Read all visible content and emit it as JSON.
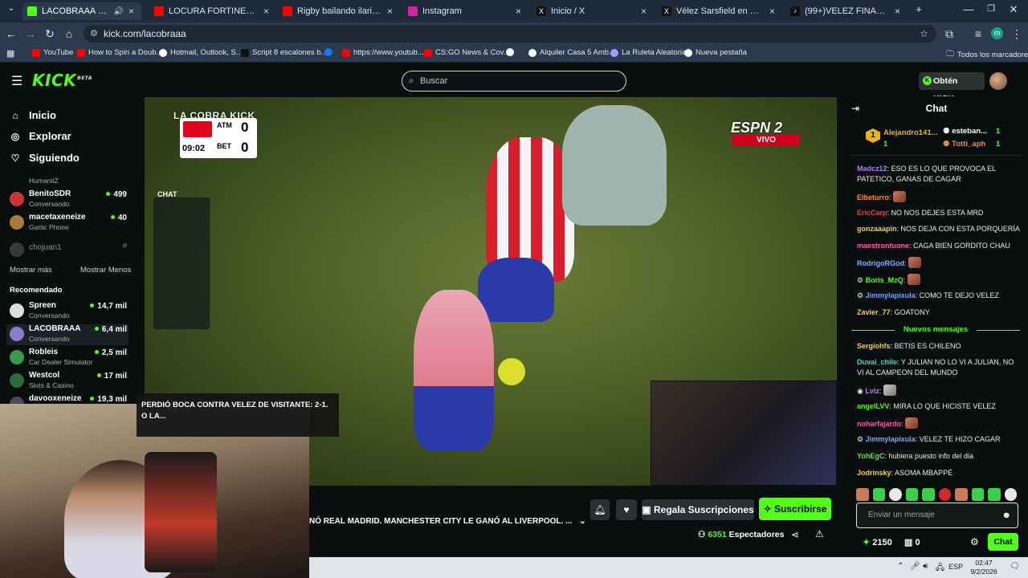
{
  "browser": {
    "tabs": [
      {
        "title": "LACOBRAAA Stream - Watc",
        "active": true,
        "color": "#53fc18"
      },
      {
        "title": "LOCURA FORTINERA | VÉLEZ 2",
        "color": "#ff0000"
      },
      {
        "title": "Rigby bailando ilarie, ilari larie",
        "color": "#ff0000"
      },
      {
        "title": "Instagram",
        "color": "#d6249f"
      },
      {
        "title": "Inicio / X",
        "color": "#111111"
      },
      {
        "title": "Vélez Sarsfield en X: \"Guille y la",
        "color": "#111111"
      },
      {
        "title": "(99+)VELEZ FINALISTA VAMOO",
        "color": "#111111"
      }
    ],
    "new_tab": "+",
    "url": "kick.com/lacobraaa",
    "bookmarks": [
      {
        "label": "YouTube",
        "color": "#ff0000"
      },
      {
        "label": "How to Spin a Doub...",
        "color": "#ff0000"
      },
      {
        "label": "Hotmail, Outlook, S...",
        "color": "#ffffff"
      },
      {
        "label": "Script 8 escalones b...",
        "color": "#222222"
      },
      {
        "label": "",
        "color": "#1877f2"
      },
      {
        "label": "https://www.youtub...",
        "color": "#ff0000"
      },
      {
        "label": "CS:GO News & Cov...",
        "color": "#ff0000"
      },
      {
        "label": "",
        "color": "#ffffff"
      },
      {
        "label": "Alquiler Casa 5 Amb...",
        "color": "#ffffff"
      },
      {
        "label": "La Ruleta Aleatoria",
        "color": "#a0a0ff"
      },
      {
        "label": "Nueva pestaña",
        "color": "#ffffff"
      }
    ],
    "all_bookmarks": "Todos los marcadores"
  },
  "header": {
    "logo": "KICK",
    "logo_beta": "BETA",
    "search_placeholder": "Buscar",
    "get_kicks": "Obtén KICKs"
  },
  "sidebar": {
    "nav": [
      {
        "label": "Inicio",
        "icon": "home-icon"
      },
      {
        "label": "Explorar",
        "icon": "compass-icon"
      },
      {
        "label": "Siguiendo",
        "icon": "heart-icon"
      }
    ],
    "following": [
      {
        "name": "HumanitZ",
        "sub": "",
        "viewers": ""
      },
      {
        "name": "BenitoSDR",
        "sub": "Conversando",
        "viewers": "499"
      },
      {
        "name": "macetaxeneize",
        "sub": "Gartic Phone",
        "viewers": "40"
      },
      {
        "name": "chojuan1",
        "sub": "",
        "viewers": ""
      }
    ],
    "show_more": "Mostrar más",
    "show_less": "Mostrar Menos",
    "recommended_title": "Recomendado",
    "recommended": [
      {
        "name": "Spreen",
        "sub": "Conversando",
        "viewers": "14,7 mil"
      },
      {
        "name": "LACOBRAAA",
        "sub": "Conversando",
        "viewers": "6,4 mil"
      },
      {
        "name": "Robleis",
        "sub": "Car Dealer Simulator",
        "viewers": "2,5 mil"
      },
      {
        "name": "Westcol",
        "sub": "Slots & Casino",
        "viewers": "17 mil"
      },
      {
        "name": "davooxeneize",
        "sub": "",
        "viewers": "19,3 mil"
      }
    ]
  },
  "video": {
    "overlay_brand": "LA COBRA KICK",
    "score": {
      "team1": "ATM",
      "team2": "BET",
      "score1": "0",
      "score2": "0",
      "clock": "09:02"
    },
    "broadcaster": "ESPN 2",
    "live_label": "VIVO",
    "chat_overlay_label": "CHAT",
    "ticker_text": "PERDIÓ BOCA CONTRA VELEZ DE VISITANTE: 2-1. O LA..."
  },
  "stream": {
    "title": "NÓ REAL MADRID. MANCHESTER CITY LE GANÓ AL LIVERPOOL. ...",
    "gift_subs": "Regala Suscripciones",
    "subscribe": "Suscribirse",
    "viewers": "6351",
    "viewers_label": "Espectadores"
  },
  "chat": {
    "title": "Chat",
    "leaderboard": [
      {
        "rank": "1",
        "name": "Alejandro141...",
        "count": "1"
      },
      {
        "name": "esteban...",
        "count": "1"
      },
      {
        "name": "Totti_aph",
        "count": "1"
      }
    ],
    "messages": [
      {
        "user": "Madcz12",
        "color": "#b57bff",
        "text": "ESO ES LO QUE PROVOCA EL PATETICO, GANAS DE CAGAR"
      },
      {
        "user": "Elbeturro",
        "color": "#ff8c3a",
        "text": ""
      },
      {
        "user": "EricCarp",
        "color": "#ff3c3c",
        "text": "NO NOS DEJES ESTA MRD"
      },
      {
        "user": "gonzaaapin",
        "color": "#f2d14b",
        "text": "NOS DEJA CON ESTA PORQUERÍA"
      },
      {
        "user": "maestrontuone",
        "color": "#ff5fa2",
        "text": "CAGA BIEN GORDITO CHAU"
      },
      {
        "user": "RodrigoRGod",
        "color": "#7fb0ff",
        "text": ""
      },
      {
        "user": "Boris_MzQ",
        "color": "#53fc18",
        "text": ""
      },
      {
        "user": "Jimmylapixula",
        "color": "#6fa8ff",
        "text": "COMO TE DEJO VELEZ"
      },
      {
        "user": "Zavier_77",
        "color": "#f2d14b",
        "text": "GOATONY"
      }
    ],
    "new_messages_label": "Nuevos mensajes",
    "new_messages": [
      {
        "user": "Sergiohfs",
        "color": "#f2d14b",
        "text": "BETIS ES CHILENO"
      },
      {
        "user": "Duvai_chile",
        "color": "#4bd6c0",
        "text": "Y JULIAN NO LO VI A JULIAN, NO VI AL CAMPEON DEL MUNDO"
      },
      {
        "user": "Lviz",
        "color": "#c07bff",
        "text": ""
      },
      {
        "user": "angelLVV",
        "color": "#53fc18",
        "text": "MIRA LO QUE HICISTE VELEZ"
      },
      {
        "user": "noharfajardo",
        "color": "#ff5fa2",
        "text": ""
      },
      {
        "user": "Jimmylapixula",
        "color": "#6fa8ff",
        "text": "VELEZ TE HIZO CAGAR"
      },
      {
        "user": "YohEgC",
        "color": "#7dd66b",
        "text": "hubiera puesto info del dia"
      },
      {
        "user": "Jodrinsky",
        "color": "#f2d14b",
        "text": "ASOMA MBAPPÉ"
      }
    ],
    "input_placeholder": "Enviar un mensaje",
    "kicks_count": "2150",
    "boxes_count": "0",
    "send_label": "Chat"
  },
  "taskbar": {
    "lang": "ESP",
    "time": "02:47",
    "date": "9/2/2026"
  }
}
